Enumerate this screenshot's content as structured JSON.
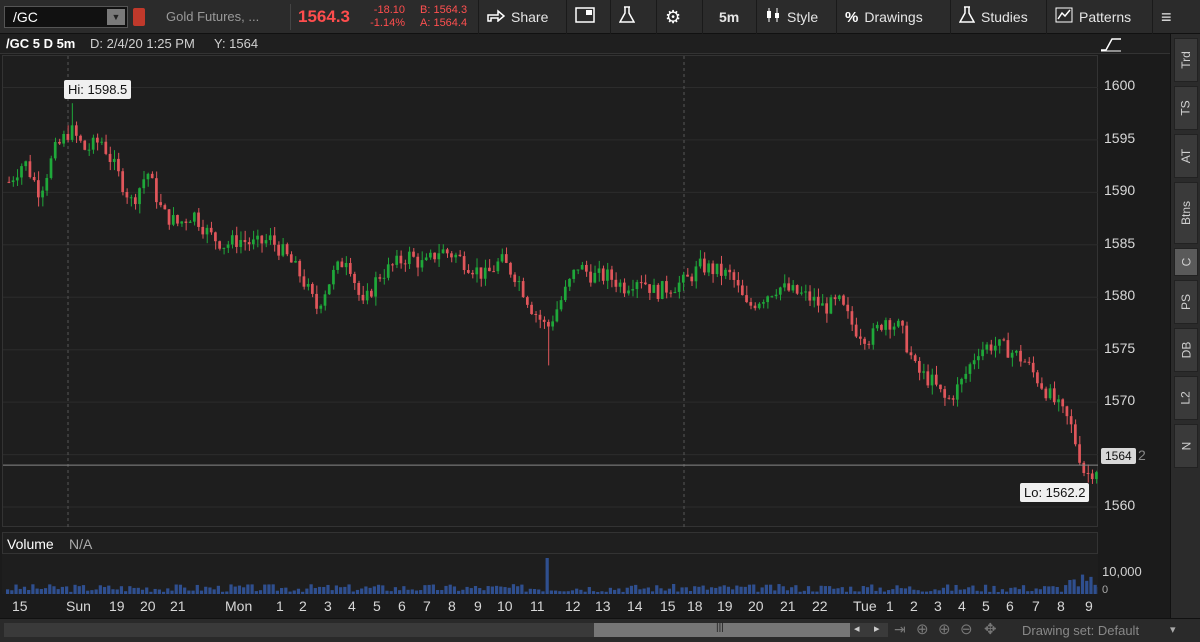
{
  "toolbar": {
    "symbol": "/GC",
    "description": "Gold Futures, ...",
    "last": "1564.3",
    "net_change": "-18.10",
    "pct_change": "-1.14%",
    "bid": "B: 1564.3",
    "ask": "A: 1564.4",
    "share_label": "Share",
    "timeframe": "5m",
    "style_label": "Style",
    "drawings_label": "Drawings",
    "studies_label": "Studies",
    "patterns_label": "Patterns"
  },
  "info_bar": {
    "title": "/GC 5 D 5m",
    "date": "D: 2/4/20 1:25 PM",
    "y": "Y: 1564"
  },
  "price_axis": {
    "ticks": [
      "1600",
      "1595",
      "1590",
      "1585",
      "1580",
      "1575",
      "1570",
      "1565",
      "1560"
    ],
    "current_label": "1564",
    "current_suffix": "2"
  },
  "annotations": {
    "hi": "Hi: 1598.5",
    "lo": "Lo: 1562.2"
  },
  "volume": {
    "title": "Volume",
    "value": "N/A",
    "axis_label": "10,000",
    "axis_zero": "0"
  },
  "time_axis": [
    "15",
    "Sun",
    "19",
    "20",
    "21",
    "Mon",
    "1",
    "2",
    "3",
    "4",
    "5",
    "6",
    "7",
    "8",
    "9",
    "10",
    "11",
    "12",
    "13",
    "14",
    "15",
    "18",
    "19",
    "20",
    "21",
    "22",
    "Tue",
    "1",
    "2",
    "3",
    "4",
    "5",
    "6",
    "7",
    "8",
    "9"
  ],
  "side_tabs": [
    "Trd",
    "TS",
    "AT",
    "Btns",
    "C",
    "PS",
    "DB",
    "L2",
    "N"
  ],
  "status": {
    "drawing_set": "Drawing set: Default"
  },
  "colors": {
    "up": "#1fa83a",
    "down": "#e0565b",
    "last_price": "#ff4d4d"
  },
  "chart_data": {
    "type": "candlestick",
    "symbol": "/GC",
    "ylim": [
      1558,
      1603
    ],
    "hi": 1598.5,
    "lo": 1562.2,
    "current": 1564,
    "path": [
      1591,
      1593,
      1590,
      1594,
      1596,
      1594,
      1595,
      1592,
      1589,
      1592,
      1588,
      1587,
      1588,
      1586,
      1585,
      1585.5,
      1585,
      1585.5,
      1584,
      1582,
      1579,
      1582,
      1584,
      1579,
      1582,
      1583,
      1584,
      1583,
      1584.5,
      1584,
      1583,
      1582,
      1583.5,
      1582,
      1579,
      1577,
      1580,
      1583,
      1582,
      1582,
      1581,
      1582,
      1580.5,
      1581,
      1581.5,
      1583,
      1582.5,
      1582,
      1579,
      1580,
      1581,
      1580.5,
      1580,
      1579,
      1579.5,
      1577,
      1576,
      1578,
      1577,
      1573,
      1572,
      1570,
      1572,
      1575,
      1575.5,
      1575,
      1574,
      1572,
      1570,
      1568,
      1563,
      1564
    ]
  }
}
